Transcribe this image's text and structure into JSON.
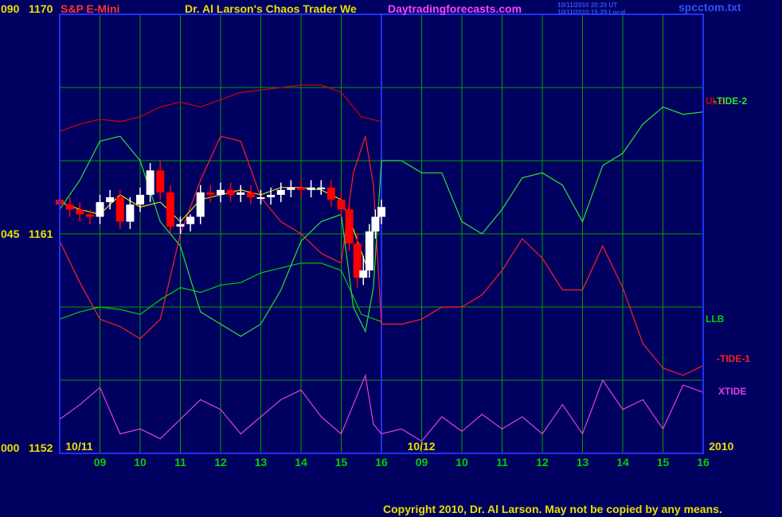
{
  "header": {
    "instrument": "S&P E-Mini",
    "title": "Dr. Al Larson's Chaos Trader We",
    "website": "Daytradingforecasts.com",
    "timestamp_ut": "10/11/2010 20:20 UT",
    "timestamp_local": "10/11/2010 15:20 Local",
    "filename": "spcctom.txt"
  },
  "footer": {
    "copyright": "Copyright 2010, Dr. Al Larson. May not be copied by any means."
  },
  "colors": {
    "background": "#000060",
    "grid": "#00a000",
    "price_up": "#ffffff",
    "price_down": "#ff0000",
    "ulb": "#d00000",
    "llb": "#00d000",
    "tide1": "#ff2020",
    "tide2": "#30e030",
    "xtide": "#e040e0",
    "average": "#e8e000",
    "now_line": "#2030ff"
  },
  "chart_data": {
    "type": "line",
    "title": "S&P E-Mini",
    "ylim": [
      1152,
      1170
    ],
    "y_ticks": [
      {
        "left": "090",
        "price": 1170,
        "label": "1170"
      },
      {
        "left": "045",
        "price": 1161,
        "label": "1161"
      },
      {
        "left": "000",
        "price": 1152,
        "label": "1152"
      }
    ],
    "x_hour_labels": [
      "09",
      "10",
      "11",
      "12",
      "13",
      "14",
      "15",
      "16",
      "09",
      "10",
      "11",
      "12",
      "13",
      "14",
      "15",
      "16"
    ],
    "date_labels": [
      {
        "text": "10/11",
        "hour": 8.5
      },
      {
        "text": "10/12",
        "hour": 17.0
      },
      {
        "text": "2010",
        "hour": 24.5
      }
    ],
    "xlim_hours": [
      8.0,
      24.0
    ],
    "now_hour": 16.0,
    "series_labels": [
      {
        "name": "ULB",
        "text": "ULB"
      },
      {
        "name": "TIDE-2",
        "text": "-TIDE-2"
      },
      {
        "name": "LLB",
        "text": "LLB"
      },
      {
        "name": "TIDE-1",
        "text": "-TIDE-1"
      },
      {
        "name": "XTIDE",
        "text": "XTIDE"
      }
    ],
    "series": [
      {
        "name": "ULB",
        "x": [
          8.0,
          8.5,
          9.0,
          9.5,
          10.0,
          10.5,
          11.0,
          11.5,
          12.0,
          12.5,
          13.0,
          13.5,
          14.0,
          14.5,
          15.0,
          15.5,
          16.0
        ],
        "values": [
          1165.2,
          1165.5,
          1165.7,
          1165.6,
          1165.8,
          1166.2,
          1166.4,
          1166.2,
          1166.5,
          1166.8,
          1166.9,
          1167.0,
          1167.1,
          1167.1,
          1166.8,
          1165.8,
          1165.6
        ]
      },
      {
        "name": "LLB",
        "x": [
          8.0,
          8.5,
          9.0,
          9.5,
          10.0,
          10.5,
          11.0,
          11.5,
          12.0,
          12.5,
          13.0,
          13.5,
          14.0,
          14.5,
          15.0,
          15.5,
          16.0
        ],
        "values": [
          1157.5,
          1157.8,
          1158.0,
          1157.9,
          1157.7,
          1158.3,
          1158.8,
          1158.6,
          1158.9,
          1159.0,
          1159.4,
          1159.6,
          1159.8,
          1159.8,
          1159.5,
          1157.7,
          1157.4
        ]
      },
      {
        "name": "TIDE-1",
        "x": [
          8.0,
          8.5,
          9.0,
          9.5,
          10.0,
          10.5,
          11.0,
          11.5,
          12.0,
          12.5,
          13.0,
          13.5,
          14.0,
          14.5,
          15.0,
          15.3,
          15.6,
          15.8,
          16.0,
          16.5,
          17.0,
          17.5,
          18.0,
          18.5,
          19.0,
          19.5,
          20.0,
          20.5,
          21.0,
          21.5,
          22.0,
          22.5,
          23.0,
          23.5,
          24.0
        ],
        "values": [
          1160.7,
          1159.0,
          1157.5,
          1157.2,
          1156.7,
          1157.5,
          1161.0,
          1163.2,
          1165.0,
          1164.8,
          1162.5,
          1161.5,
          1161.0,
          1160.2,
          1159.8,
          1163.5,
          1165.0,
          1163.0,
          1157.3,
          1157.3,
          1157.5,
          1158.0,
          1158.0,
          1158.5,
          1159.5,
          1160.8,
          1160.0,
          1158.7,
          1158.7,
          1160.5,
          1158.8,
          1156.5,
          1155.5,
          1155.2,
          1155.6
        ]
      },
      {
        "name": "TIDE-2",
        "x": [
          8.0,
          8.5,
          9.0,
          9.5,
          10.0,
          10.5,
          11.0,
          11.5,
          12.0,
          12.5,
          13.0,
          13.5,
          14.0,
          14.5,
          15.0,
          15.3,
          15.6,
          15.8,
          16.0,
          16.5,
          17.0,
          17.5,
          18.0,
          18.5,
          19.0,
          19.5,
          20.0,
          20.5,
          21.0,
          21.5,
          22.0,
          22.5,
          23.0,
          23.5,
          24.0
        ],
        "values": [
          1162.0,
          1163.2,
          1164.8,
          1165.0,
          1164.0,
          1161.5,
          1160.5,
          1157.8,
          1157.3,
          1156.8,
          1157.3,
          1158.7,
          1160.7,
          1161.5,
          1161.8,
          1158.0,
          1157.0,
          1158.8,
          1164.0,
          1164.0,
          1163.5,
          1163.5,
          1161.5,
          1161.0,
          1162.0,
          1163.3,
          1163.5,
          1163.0,
          1161.5,
          1163.8,
          1164.3,
          1165.5,
          1166.2,
          1165.9,
          1166.0
        ]
      },
      {
        "name": "XTIDE",
        "x": [
          8.0,
          8.5,
          9.0,
          9.5,
          10.0,
          10.5,
          11.0,
          11.5,
          12.0,
          12.5,
          13.0,
          13.5,
          14.0,
          14.5,
          15.0,
          15.3,
          15.6,
          15.8,
          16.0,
          16.5,
          17.0,
          17.5,
          18.0,
          18.5,
          19.0,
          19.5,
          20.0,
          20.5,
          21.0,
          21.5,
          22.0,
          22.5,
          23.0,
          23.5,
          24.0
        ],
        "values": [
          1153.4,
          1154.0,
          1154.7,
          1152.8,
          1153.0,
          1152.6,
          1153.4,
          1154.2,
          1153.8,
          1152.8,
          1153.5,
          1154.2,
          1154.6,
          1153.5,
          1152.8,
          1154.0,
          1155.2,
          1153.2,
          1152.8,
          1153.0,
          1152.5,
          1153.5,
          1152.9,
          1153.6,
          1153.0,
          1153.5,
          1152.8,
          1154.0,
          1152.8,
          1155.0,
          1153.8,
          1154.2,
          1153.0,
          1154.8,
          1154.5
        ]
      },
      {
        "name": "Average",
        "x": [
          8.0,
          8.5,
          9.0,
          9.5,
          10.0,
          10.5,
          11.0,
          11.5,
          12.0,
          12.5,
          13.0,
          13.5,
          14.0,
          14.5,
          15.0,
          15.3,
          15.6,
          15.8,
          16.0
        ],
        "values": [
          1162.3,
          1162.0,
          1161.8,
          1162.6,
          1162.1,
          1162.3,
          1161.5,
          1162.4,
          1162.6,
          1162.8,
          1162.6,
          1162.9,
          1162.9,
          1162.8,
          1162.4,
          1161.2,
          1159.8,
          1161.1,
          1161.9
        ]
      }
    ],
    "price_bars": {
      "x": [
        8.0,
        8.25,
        8.5,
        8.75,
        9.0,
        9.25,
        9.5,
        9.75,
        10.0,
        10.25,
        10.5,
        10.75,
        11.0,
        11.25,
        11.5,
        11.75,
        12.0,
        12.25,
        12.5,
        12.75,
        13.0,
        13.25,
        13.5,
        13.75,
        14.0,
        14.25,
        14.5,
        14.75,
        15.0,
        15.2,
        15.4,
        15.55,
        15.7,
        15.85,
        16.0
      ],
      "open": [
        1162.4,
        1162.2,
        1162.0,
        1161.8,
        1161.7,
        1162.3,
        1162.5,
        1161.5,
        1162.2,
        1162.6,
        1163.6,
        1162.7,
        1161.3,
        1161.4,
        1161.7,
        1162.7,
        1162.6,
        1162.8,
        1162.6,
        1162.7,
        1162.5,
        1162.5,
        1162.6,
        1162.8,
        1162.9,
        1162.8,
        1162.9,
        1162.9,
        1162.4,
        1162.0,
        1160.6,
        1159.2,
        1159.5,
        1161.1,
        1161.7
      ],
      "close": [
        1162.2,
        1162.0,
        1161.8,
        1161.7,
        1162.3,
        1162.5,
        1161.5,
        1162.2,
        1162.6,
        1163.6,
        1162.7,
        1161.3,
        1161.4,
        1161.7,
        1162.7,
        1162.6,
        1162.8,
        1162.6,
        1162.7,
        1162.5,
        1162.5,
        1162.6,
        1162.8,
        1162.9,
        1162.8,
        1162.9,
        1162.9,
        1162.4,
        1162.0,
        1160.6,
        1159.2,
        1159.5,
        1161.1,
        1161.7,
        1162.1
      ],
      "high": [
        1162.7,
        1162.5,
        1162.3,
        1162.0,
        1162.6,
        1162.8,
        1162.8,
        1162.5,
        1162.9,
        1163.9,
        1164.0,
        1163.0,
        1161.7,
        1161.8,
        1163.0,
        1163.0,
        1163.1,
        1163.1,
        1163.0,
        1163.0,
        1162.8,
        1162.9,
        1163.1,
        1163.2,
        1163.2,
        1163.2,
        1163.2,
        1163.2,
        1162.7,
        1162.3,
        1161.0,
        1160.1,
        1161.4,
        1162.0,
        1162.4
      ],
      "low": [
        1161.9,
        1161.7,
        1161.5,
        1161.4,
        1161.4,
        1162.0,
        1161.2,
        1161.2,
        1161.9,
        1162.3,
        1162.4,
        1161.0,
        1161.0,
        1161.1,
        1161.4,
        1162.3,
        1162.3,
        1162.3,
        1162.3,
        1162.2,
        1162.2,
        1162.2,
        1162.3,
        1162.5,
        1162.5,
        1162.5,
        1162.6,
        1162.1,
        1161.7,
        1160.3,
        1158.8,
        1158.9,
        1159.2,
        1160.8,
        1161.4
      ]
    }
  }
}
